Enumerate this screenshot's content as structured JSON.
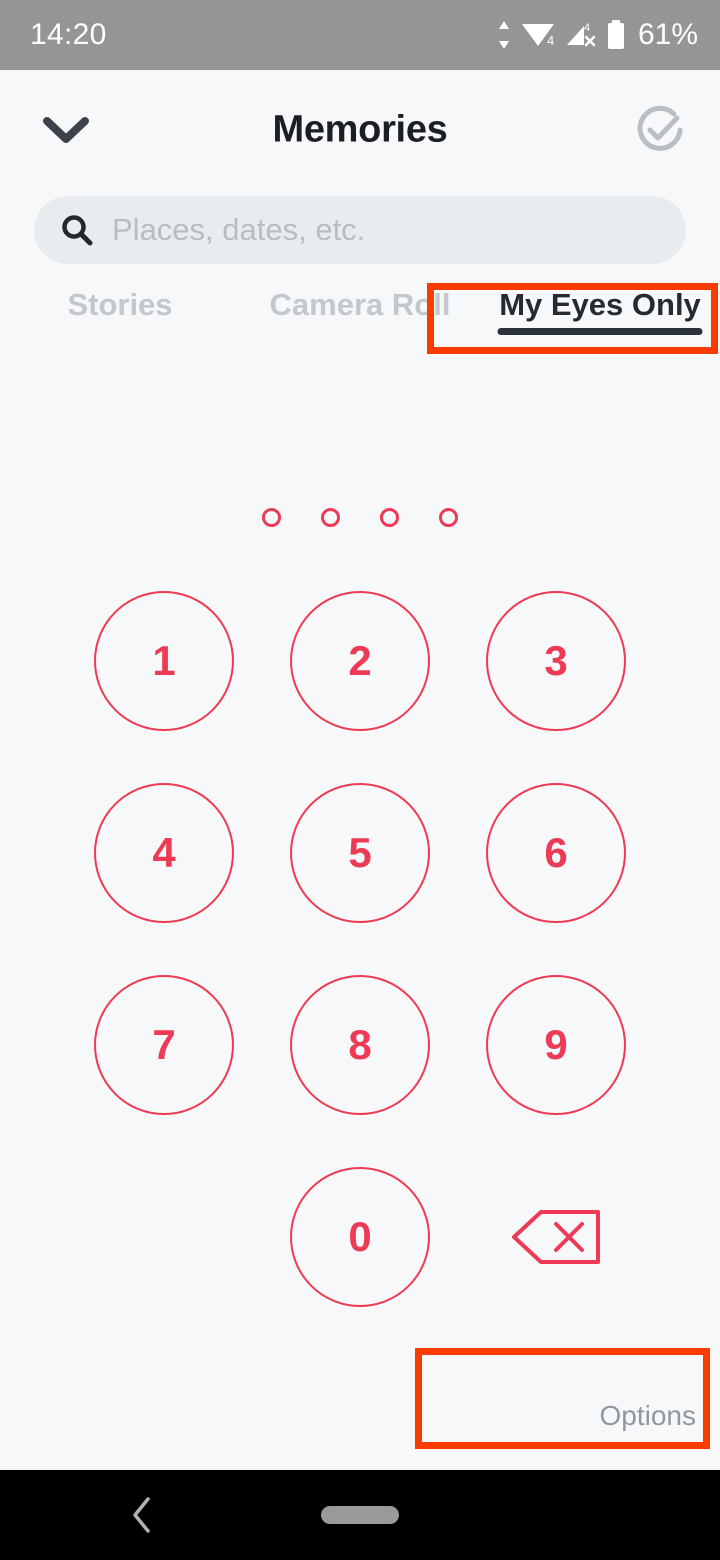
{
  "status_bar": {
    "time": "14:20",
    "battery_percent": "61%",
    "icons": [
      "data-transfer-icon",
      "wifi-icon",
      "cellular-no-signal-icon",
      "battery-icon"
    ],
    "wifi_badge": "4",
    "background_color": "#959595"
  },
  "header": {
    "title": "Memories",
    "back_icon": "chevron-down-icon",
    "select_icon": "check-circle-icon"
  },
  "search": {
    "placeholder": "Places, dates, etc.",
    "value": "",
    "icon": "search-icon"
  },
  "tabs": [
    {
      "label": "Stories",
      "active": false
    },
    {
      "label": "Camera Roll",
      "active": false
    },
    {
      "label": "My Eyes Only",
      "active": true
    }
  ],
  "passcode": {
    "dots": [
      "",
      "",
      "",
      ""
    ],
    "entered_count": 0,
    "accent_color": "#ee3a55",
    "keypad_rows": [
      [
        {
          "label": "1",
          "type": "digit"
        },
        {
          "label": "2",
          "type": "digit"
        },
        {
          "label": "3",
          "type": "digit"
        }
      ],
      [
        {
          "label": "4",
          "type": "digit"
        },
        {
          "label": "5",
          "type": "digit"
        },
        {
          "label": "6",
          "type": "digit"
        }
      ],
      [
        {
          "label": "7",
          "type": "digit"
        },
        {
          "label": "8",
          "type": "digit"
        },
        {
          "label": "9",
          "type": "digit"
        }
      ],
      [
        {
          "label": "",
          "type": "blank"
        },
        {
          "label": "0",
          "type": "digit"
        },
        {
          "label": "",
          "type": "delete",
          "icon": "backspace-icon"
        }
      ]
    ]
  },
  "options": {
    "label": "Options"
  },
  "annotations": [
    {
      "name": "highlight-my-eyes-only-tab",
      "color": "#fa3c00"
    },
    {
      "name": "highlight-options-button",
      "color": "#fa3c00"
    }
  ],
  "nav_bar": {
    "back_icon": "nav-back-icon",
    "home_icon": "nav-home-pill"
  }
}
